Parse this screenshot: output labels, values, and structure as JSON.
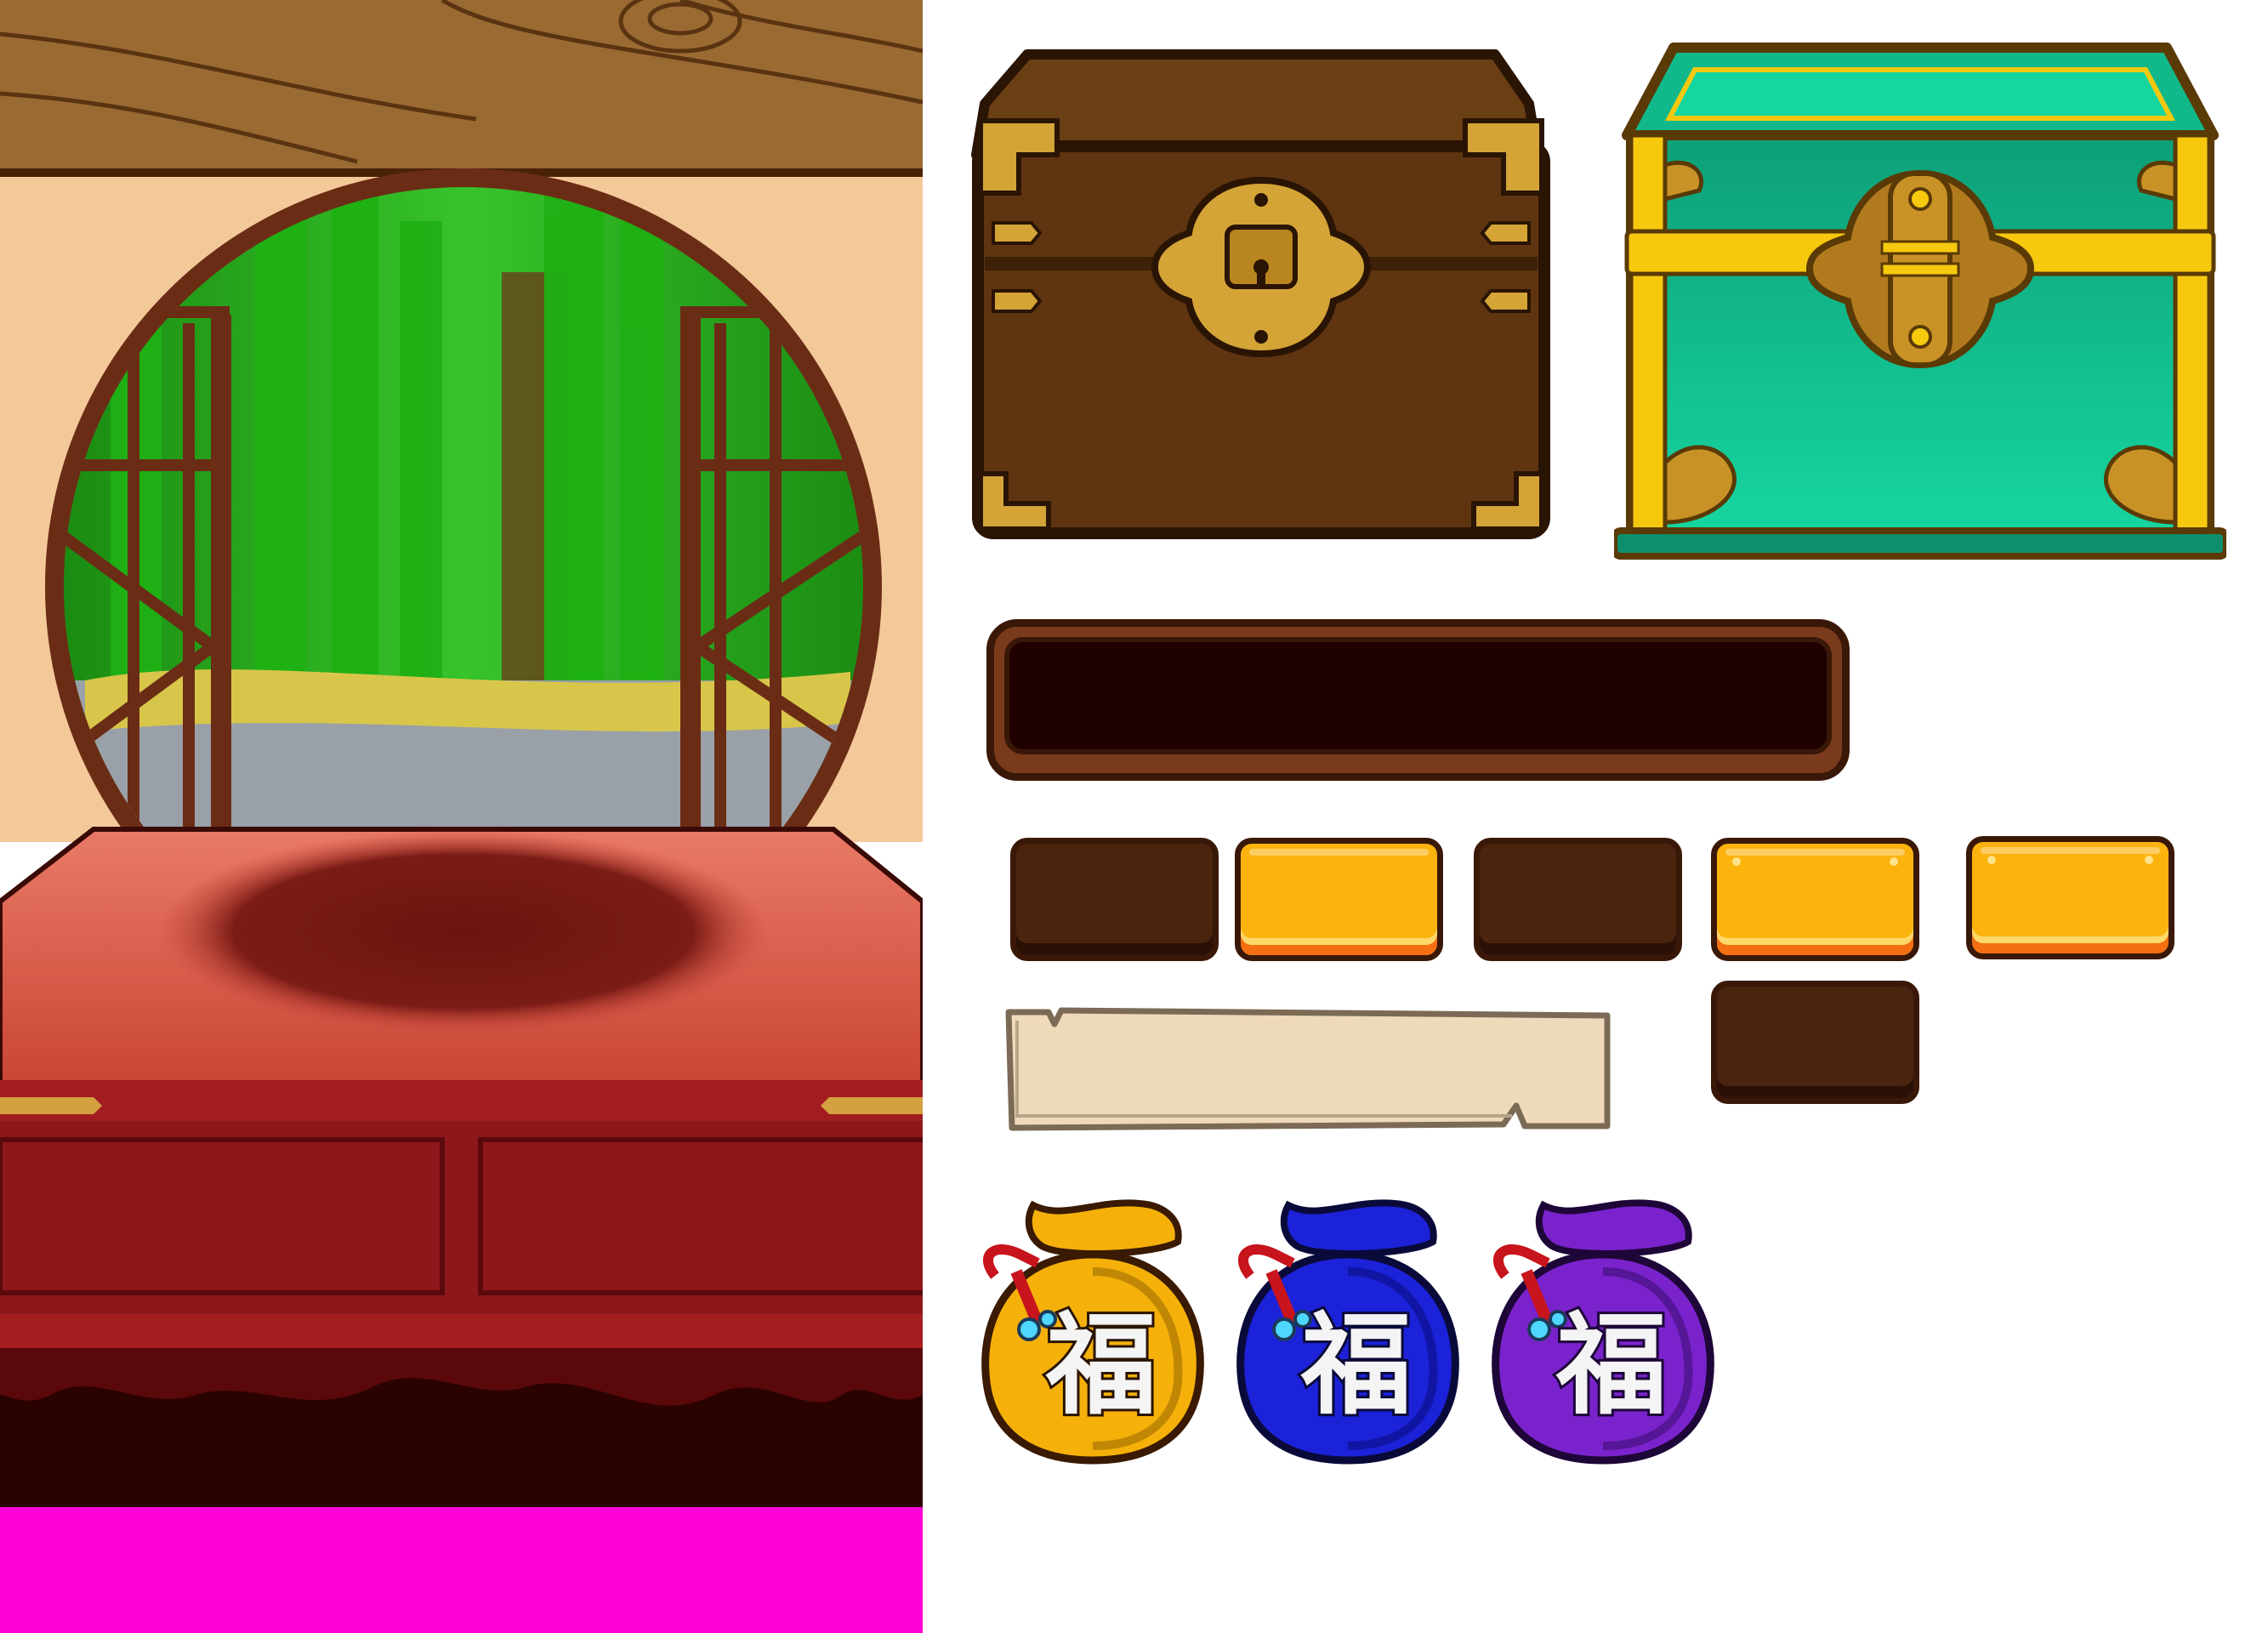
{
  "sheet": {
    "background": "#ffffff",
    "scene": {
      "wall_color": "#f3c99a",
      "beam_color": "#9a6a33",
      "window_frame_color": "#6b2c16",
      "bamboo_color": "#26b319",
      "table_top_color": "#d95a4a",
      "table_body_color": "#8e171b",
      "magenta_strip_color": "#ff00d8"
    },
    "chests": [
      {
        "name": "wooden-chest",
        "body_color": "#6b3f14",
        "trim_color": "#d4a437"
      },
      {
        "name": "jade-chest",
        "body_color": "#12c08f",
        "trim_color": "#f7c90e"
      }
    ],
    "progress_bar": {
      "frame_color": "#7a3b1c",
      "fill_color": "#1f0000"
    },
    "tiles": [
      {
        "style": "dark"
      },
      {
        "style": "gold"
      },
      {
        "style": "dark"
      },
      {
        "style": "gold"
      },
      {
        "style": "gold"
      },
      {
        "style": "dark"
      }
    ],
    "scroll_banner": {
      "color": "#efd9bb"
    },
    "pouches": [
      {
        "glyph": "福",
        "color": "#f5b10a",
        "shade": "#9c6b00"
      },
      {
        "glyph": "福",
        "color": "#1b22d8",
        "shade": "#0c0e80"
      },
      {
        "glyph": "福",
        "color": "#7a23cc",
        "shade": "#3d0d75"
      }
    ]
  }
}
